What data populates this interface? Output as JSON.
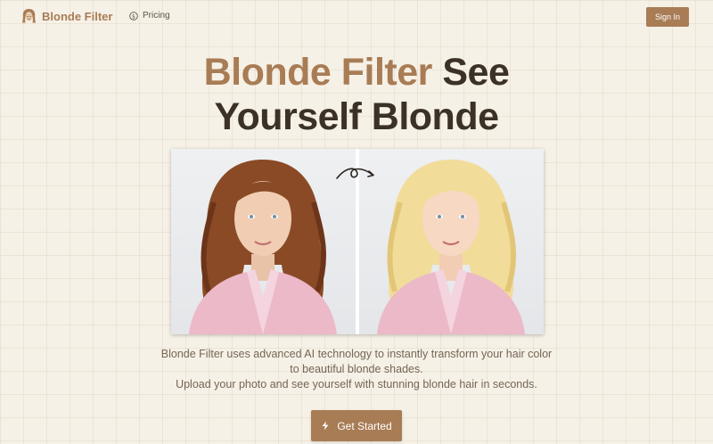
{
  "nav": {
    "brand": "Blonde Filter",
    "brand_icon": "hair-face-icon",
    "pricing_label": "Pricing",
    "pricing_icon": "dollar-circle-icon",
    "signin_label": "Sign In"
  },
  "hero": {
    "title_accent": "Blonde Filter",
    "title_rest_1": "See",
    "title_rest_2": "Yourself Blonde",
    "before_alt": "Woman with curly auburn hair in pink blazer",
    "after_alt": "Same woman with curly blonde hair in pink blazer",
    "transform_icon": "looped-arrow-icon",
    "description_1": "Blonde Filter uses advanced AI technology to instantly transform your hair color",
    "description_2": "to beautiful blonde shades.",
    "description_3": "Upload your photo and see yourself with stunning blonde hair in seconds.",
    "cta_label": "Get Started",
    "cta_icon": "lightning-icon"
  },
  "colors": {
    "accent": "#a87c55",
    "background": "#f6f1e7",
    "heading_dark": "#3b3127",
    "body_text": "#756655"
  }
}
